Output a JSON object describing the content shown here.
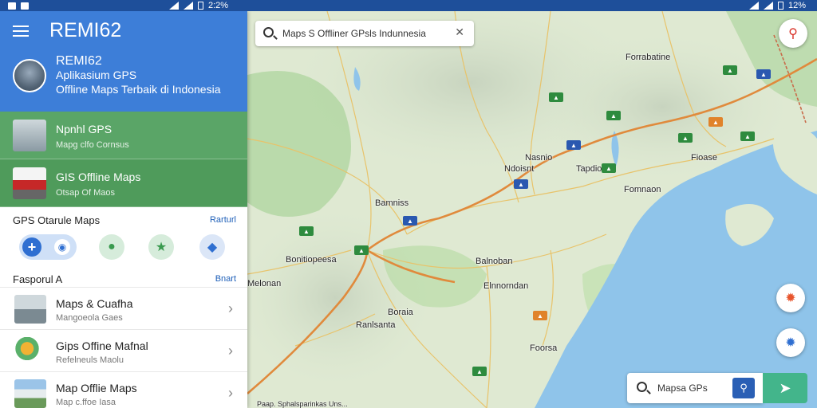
{
  "status_bar": {
    "left_time": "2:2%",
    "right_text": "12%"
  },
  "drawer": {
    "app_title": "REMI62",
    "profile": {
      "name": "REMI62",
      "subtitle1": "Aplikasium GPS",
      "subtitle2": "Offline Maps Terbaik di Indonesia"
    },
    "green_items": [
      {
        "title": "Npnhl GPS",
        "subtitle": "Mapg clfo Cornsus"
      },
      {
        "title": "GIS Offline Maps",
        "subtitle": "Otsap Of Maos"
      }
    ],
    "section1": {
      "label": "GPS Otarule Maps",
      "action": "Rarturl"
    },
    "quick_actions": [
      {
        "icon": "plus-icon",
        "glyph": "+"
      },
      {
        "icon": "chat-icon",
        "glyph": "●"
      },
      {
        "icon": "star-icon",
        "glyph": "★"
      },
      {
        "icon": "map-icon",
        "glyph": "◆"
      }
    ],
    "section2": {
      "label": "Fasporul A",
      "action": "Bnart"
    },
    "list_items": [
      {
        "title": "Maps & Cuafha",
        "subtitle": "Mangoeola Gaes"
      },
      {
        "title": "Gips Offine Mafnal",
        "subtitle": "Refelneuls Maolu"
      },
      {
        "title": "Map Offlie Maps",
        "subtitle": "Map c.ffoe Iasa"
      }
    ]
  },
  "map": {
    "search_placeholder": "Maps S Offliner GPsls Indunnesia",
    "bottom_search": "Mapsa GPs",
    "labels": [
      {
        "text": "Forrabatine"
      },
      {
        "text": "Nasnio"
      },
      {
        "text": "Ndoisnt"
      },
      {
        "text": "Tapdio"
      },
      {
        "text": "Bamniss"
      },
      {
        "text": "Fomnaon"
      },
      {
        "text": "Bonitiopeesa"
      },
      {
        "text": "Balnoban"
      },
      {
        "text": "Elnnorndan"
      },
      {
        "text": "Melonan"
      },
      {
        "text": "Boraia"
      },
      {
        "text": "Ranlsanta"
      },
      {
        "text": "Foorsa"
      },
      {
        "text": "Fioase"
      },
      {
        "text": "Paap. Sphalsparinkas Uns..."
      }
    ]
  },
  "colors": {
    "drawer_header": "#3d7ed8",
    "green_item": "#5aa567",
    "status_bar": "#1e4f9a",
    "water": "#8fc4ea",
    "nav_button": "#43b58b"
  }
}
